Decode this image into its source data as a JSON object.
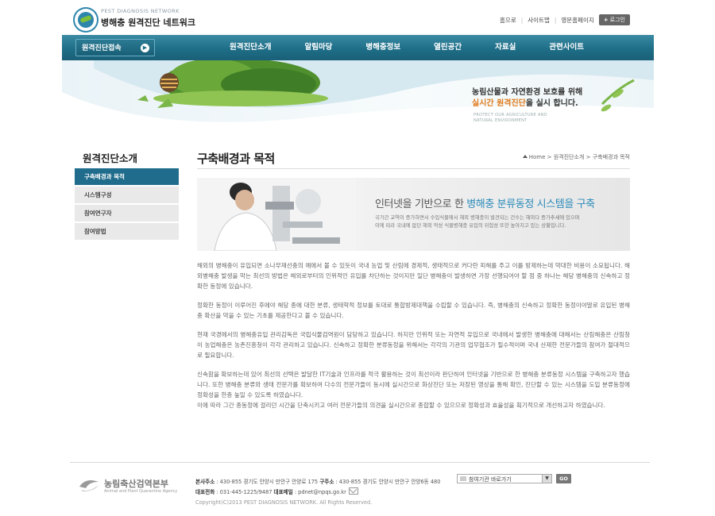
{
  "header": {
    "logo_en": "PEST DIAGNOSIS NETWORK",
    "logo_ko": "병해충 원격진단 네트워크",
    "util_links": [
      "홈으로",
      "사이트맵",
      "영문홈페이지"
    ],
    "login_label": "로그인"
  },
  "nav": {
    "remote_label": "원격진단접속",
    "items": [
      "원격진단소개",
      "알림마당",
      "병해충정보",
      "열린공간",
      "자료실",
      "관련사이트"
    ]
  },
  "banner": {
    "line1": "농림산물과 자연환경 보호를 위해",
    "line2_highlight": "실시간 원격진단",
    "line2_rest": "을 실시 합니다.",
    "sub1": "PROTECT OUR AGRICULTURE AND",
    "sub2": "NATURAL ENVIRONMENT"
  },
  "sidebar": {
    "title": "원격진단소개",
    "items": [
      "구축배경과 목적",
      "시스템구성",
      "참여연구자",
      "참여방법"
    ]
  },
  "content": {
    "title": "구축배경과 목적",
    "breadcrumb": [
      "Home",
      "원격진단소개",
      "구축배경과 목적"
    ],
    "hero_prefix": "인터넷을 기반으로 한 ",
    "hero_highlight": "병해충 분류동정 시스템을 구축",
    "hero_desc1": "국가간 교역이 증가하면서 수입식물에서 해외 병해충이 발견되는 건수는 해마다 증가추세에 있으며",
    "hero_desc2": "이에 따라 국내에 없던 해외 악성 식물병해충 유입의 위험성 또한 높아지고 있는 상황입니다.",
    "paragraphs": [
      "해외의 병해충이 유입되면 소나무재선충의 예에서 볼 수 있듯이 국내 농업 및 산림에 경제적, 생태적으로 커다란 피해를 주고 이를 방제하는데 막대한 비용이 소요됩니다. 해외병해충 발생을 막는 최선의 방법은 해외로부터의 인위적인 유입를 차단하는 것이지만 일단 병해충이 발생하면 가장 선행되어야 할 점 중 하나는 해당 병해충의 신속하고 정확한 동정에 있습니다.",
      "정확한 동정이 이루어진 후에야 해당 종에 대한 분류, 생태학적 정보를 토대로 통합방제대책을 수립할 수 있습니다. 즉, 병해충의 신속하고 정확한 동정이야말로 유입된 병해충 확산을 막을 수 있는 기초를 제공한다고 볼 수 있습니다.",
      "현재 국경에서의 병해충유입 관리감독은 국립식물검역원이 담당하고 있습니다. 하지만 인위적 또는 자연적 유입으로 국내에서 발생한 병해충에 대해서는 산림해충은 산림청이 농업해충은 농촌진흥청이 각각 관리하고 있습니다. 신속하고 정확한 분류동정을 위해서는 각각의 기관의 업무협조가 필수적이며 국내 산재한 전문가들의 참여가 절대적으로 필요합니다.",
      "신속함을 확보하는데 있어 최선의 선택은 발달한 IT기술과 인프라를 적극 활용하는 것이 최선이라 판단하여 인터넷을 기반으로 한 병해충 분류동정 시스템을 구축하고자 했습니다. 또한 병해충 분류와 생태 전문가를 확보하여 다수의 전문가들이 동시에 실시간으로 화상진단 또는 저장된 영상을 통해 확인, 진단할 수 있는 시스템을 도입 분류동정에 정확성을 한층 높일 수 있도록 하였습니다.\n이에 따라 그간 종동정에 걸리던 시간을 단축시키고 여러 전문가들의 의견을 실시간으로 종합할 수 있으므로 정확성과 효율성을 획기적으로 개선하고자 하였습니다."
    ]
  },
  "footer": {
    "logo_ko": "농림축산검역본부",
    "logo_en": "Animal and Plant Quarantine Agency",
    "address_label1": "본사주소",
    "address1": " : 430-855 경기도 안양시 만안구 안양로 175  ",
    "address_label2": "구주소",
    "address2": " : 430-855 경기도 안양시 만안구 안양6동 480",
    "phone_label": "대표전화",
    "phone": " : 031-445-1225/9487  ",
    "email_label": "대표메일",
    "email": " : pdnet@npqs.go.kr",
    "copyright": "Copyright(C)2013 PEST DIAGNOSIS NETWORK. All Rights Reserved.",
    "select_value": "참여기관 바로가기",
    "go_label": "GO"
  }
}
